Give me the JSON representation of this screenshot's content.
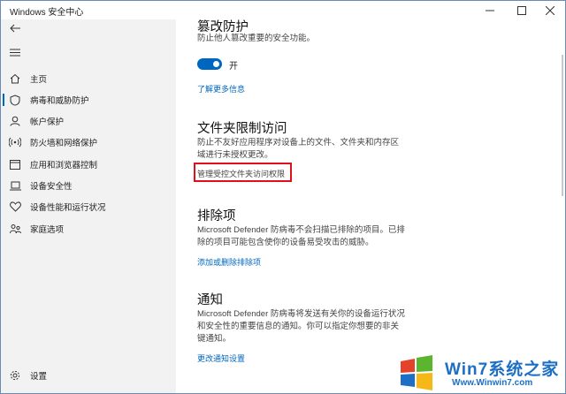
{
  "window": {
    "title": "Windows 安全中心"
  },
  "sidebar": {
    "items": [
      {
        "label": "主页",
        "icon": "home-icon"
      },
      {
        "label": "病毒和威胁防护",
        "icon": "shield-icon"
      },
      {
        "label": "帐户保护",
        "icon": "person-icon"
      },
      {
        "label": "防火墙和网络保护",
        "icon": "wireless-icon"
      },
      {
        "label": "应用和浏览器控制",
        "icon": "app-window-icon"
      },
      {
        "label": "设备安全性",
        "icon": "laptop-icon"
      },
      {
        "label": "设备性能和运行状况",
        "icon": "heart-icon"
      },
      {
        "label": "家庭选项",
        "icon": "family-icon"
      }
    ],
    "settings_label": "设置"
  },
  "main": {
    "tamper": {
      "title": "篡改防护",
      "desc": "防止他人篡改重要的安全功能。",
      "toggle_label": "开",
      "toggle_on": true,
      "link": "了解更多信息"
    },
    "folder": {
      "title": "文件夹限制访问",
      "desc": "防止不友好应用程序对设备上的文件、文件夹和内存区域进行未授权更改。",
      "link": "管理受控文件夹访问权限"
    },
    "exclusions": {
      "title": "排除项",
      "desc": "Microsoft Defender 防病毒不会扫描已排除的项目。已排除的项目可能包含使你的设备易受攻击的威胁。",
      "link": "添加或删除排除项"
    },
    "notifications": {
      "title": "通知",
      "desc": "Microsoft Defender 防病毒将发送有关你的设备运行状况和安全性的重要信息的通知。你可以指定你想要的非关键通知。",
      "link": "更改通知设置"
    }
  },
  "watermark": {
    "brand": "Win7系统之家",
    "url": "Www.Winwin7.com"
  },
  "colors": {
    "accent": "#0067c0",
    "highlight_box": "#e0101b",
    "sidebar_bg": "#f2f2f2"
  }
}
